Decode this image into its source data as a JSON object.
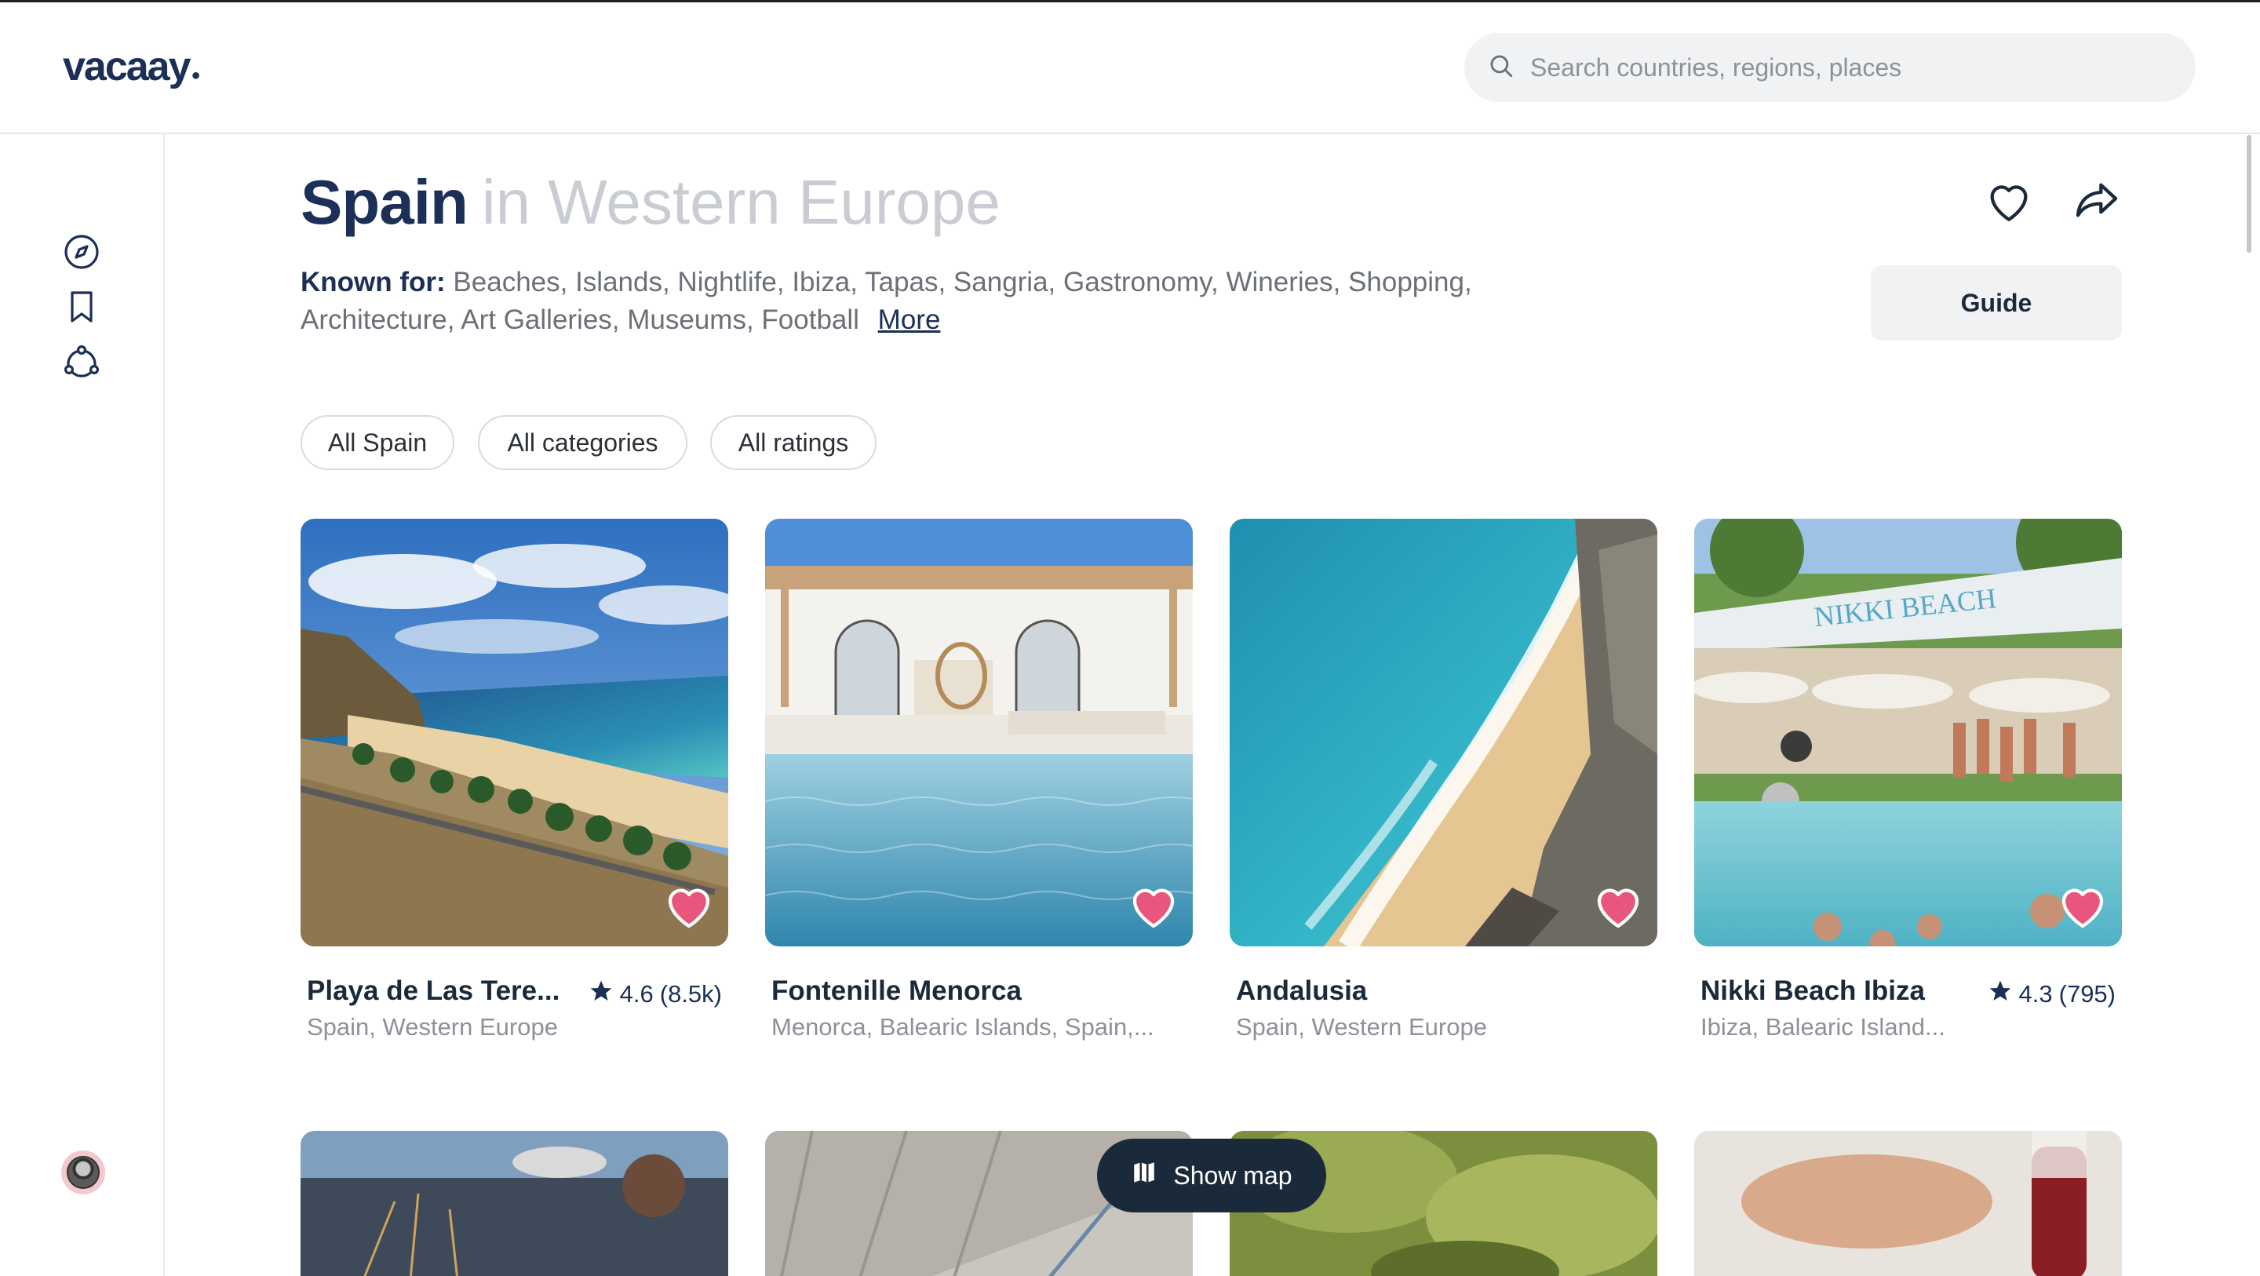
{
  "app": {
    "logo": "vacaay"
  },
  "search": {
    "placeholder": "Search countries, regions, places"
  },
  "sidebar": {
    "items": [
      {
        "icon": "compass-icon"
      },
      {
        "icon": "bookmark-icon"
      },
      {
        "icon": "community-icon"
      }
    ],
    "avatar": "user-avatar"
  },
  "page": {
    "title": "Spain",
    "subtitle": "in Western Europe",
    "known_for_label": "Known for:",
    "known_for_text": "Beaches, Islands, Nightlife, Ibiza, Tapas, Sangria, Gastronomy, Wineries, Shopping, Architecture, Art Galleries, Museums, Football",
    "more_label": "More",
    "guide_label": "Guide"
  },
  "filters": [
    {
      "label": "All Spain"
    },
    {
      "label": "All categories"
    },
    {
      "label": "All ratings"
    }
  ],
  "cards": [
    {
      "name": "Playa de Las Tere...",
      "location": "Spain, Western Europe",
      "rating": "4.6",
      "count": "(8.5k)"
    },
    {
      "name": "Fontenille Menorca",
      "location": "Menorca, Balearic Islands, Spain,...",
      "rating": "",
      "count": ""
    },
    {
      "name": "Andalusia",
      "location": "Spain, Western Europe",
      "rating": "",
      "count": ""
    },
    {
      "name": "Nikki Beach Ibiza",
      "location": "Ibiza, Balearic Island...",
      "rating": "4.3",
      "count": "(795)"
    }
  ],
  "nikki_sign": "NIKKI BEACH",
  "show_map_label": "Show map",
  "colors": {
    "brand": "#1b2f57",
    "heart": "#e8567e",
    "muted": "#8d9198",
    "button_dark": "#1b2a3a"
  }
}
